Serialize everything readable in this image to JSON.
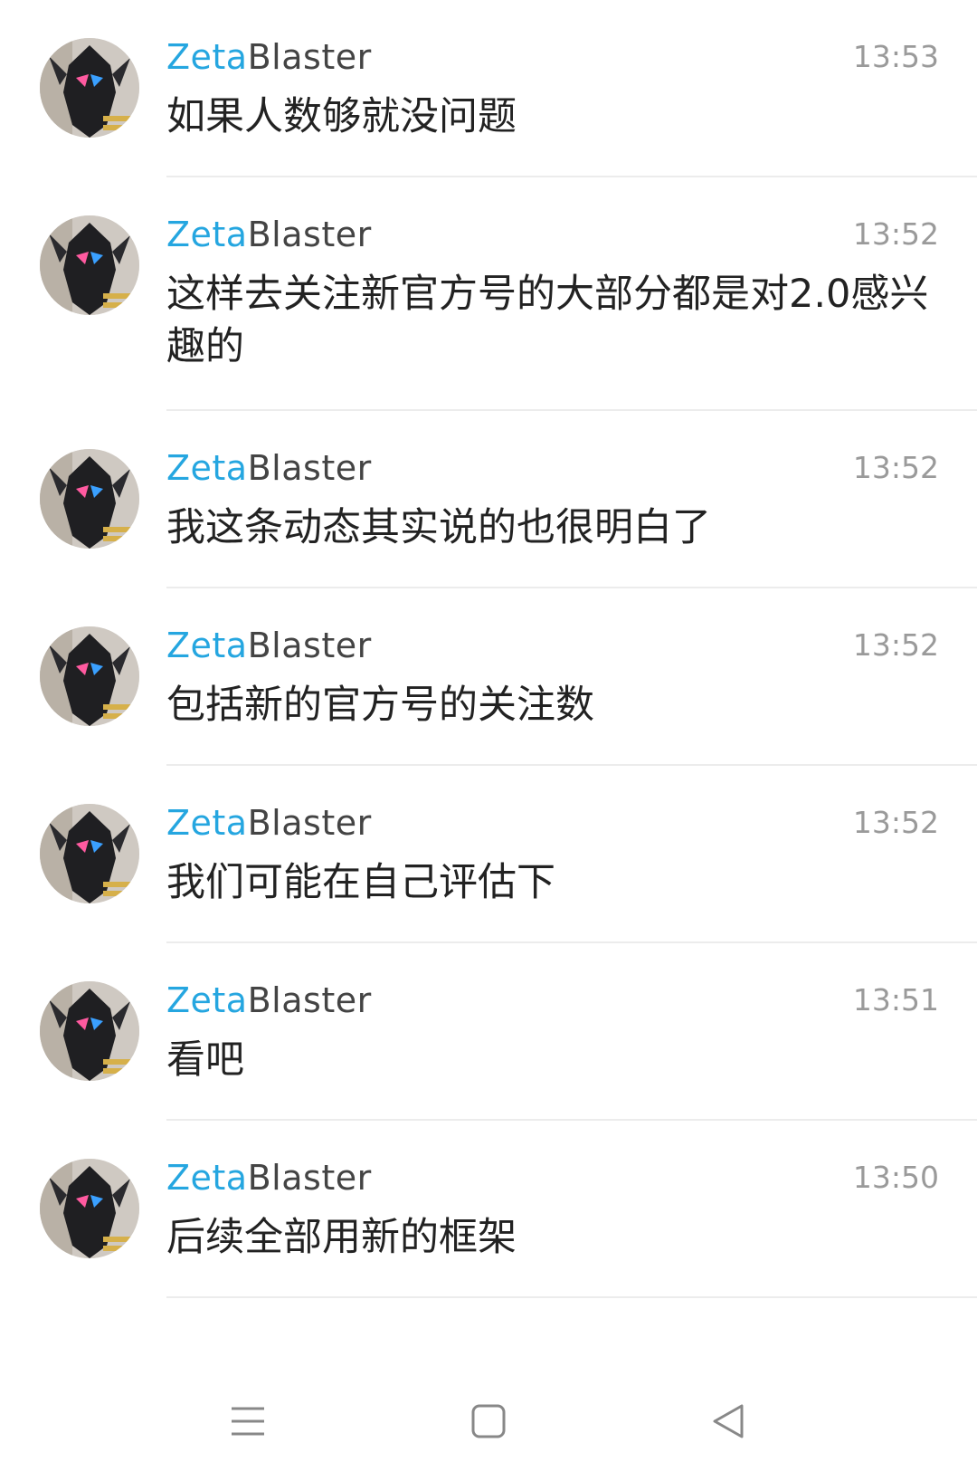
{
  "messages": [
    {
      "sender_prefix": "Zeta",
      "sender_suffix": "Blaster",
      "time": "13:53",
      "text": "如果人数够就没问题"
    },
    {
      "sender_prefix": "Zeta",
      "sender_suffix": "Blaster",
      "time": "13:52",
      "text": "这样去关注新官方号的大部分都是对2.0感兴趣的"
    },
    {
      "sender_prefix": "Zeta",
      "sender_suffix": "Blaster",
      "time": "13:52",
      "text": "我这条动态其实说的也很明白了"
    },
    {
      "sender_prefix": "Zeta",
      "sender_suffix": "Blaster",
      "time": "13:52",
      "text": "包括新的官方号的关注数"
    },
    {
      "sender_prefix": "Zeta",
      "sender_suffix": "Blaster",
      "time": "13:52",
      "text": "我们可能在自己评估下"
    },
    {
      "sender_prefix": "Zeta",
      "sender_suffix": "Blaster",
      "time": "13:51",
      "text": "看吧"
    },
    {
      "sender_prefix": "Zeta",
      "sender_suffix": "Blaster",
      "time": "13:50",
      "text": "后续全部用新的框架"
    }
  ],
  "colors": {
    "sender_accent": "#25a6e0",
    "sender_rest": "#444444",
    "time": "#9a9a9a",
    "text": "#222222",
    "nav_icon": "#888888"
  },
  "navbar": {
    "icons": [
      "menu-icon",
      "home-square-icon",
      "back-triangle-icon"
    ]
  }
}
